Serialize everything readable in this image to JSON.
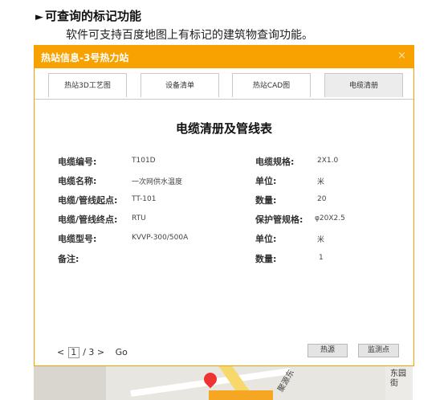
{
  "section": {
    "heading_marker": "►",
    "heading": "可查询的标记功能",
    "description": "软件可支持百度地图上有标记的建筑物查询功能。"
  },
  "map": {
    "road_label": "聚源东",
    "street_label": "东园街"
  },
  "dialog": {
    "title": "热站信息-3号热力站",
    "close": "×",
    "tabs": [
      {
        "label": "热站3D工艺图",
        "active": false
      },
      {
        "label": "设备清单",
        "active": false
      },
      {
        "label": "热站CAD图",
        "active": false
      },
      {
        "label": "电缆清册",
        "active": true
      }
    ],
    "content_title": "电缆清册及管线表",
    "left_fields": [
      {
        "label": "电缆编号:",
        "value": "T101D"
      },
      {
        "label": "电缆名称:",
        "value": "一次网供水温度"
      },
      {
        "label": "电缆/管线起点:",
        "value": "TT-101"
      },
      {
        "label": "电缆/管线终点:",
        "value": "RTU"
      },
      {
        "label": "电缆型号:",
        "value": "KVVP-300/500A"
      },
      {
        "label": "备注:",
        "value": ""
      }
    ],
    "right_fields": [
      {
        "label": "电缆规格:",
        "value": "2X1.0"
      },
      {
        "label": "单位:",
        "value": "米"
      },
      {
        "label": "数量:",
        "value": "20"
      },
      {
        "label": "保护管规格:",
        "value": "φ20X2.5"
      },
      {
        "label": "单位:",
        "value": "米"
      },
      {
        "label": "数量:",
        "value": "1"
      }
    ],
    "pager": {
      "prev": "<",
      "current": "1",
      "total": "/ 3",
      "next": ">",
      "go": "Go"
    },
    "buttons": {
      "hot_network": "热源",
      "monitor_point": "监测点"
    }
  }
}
